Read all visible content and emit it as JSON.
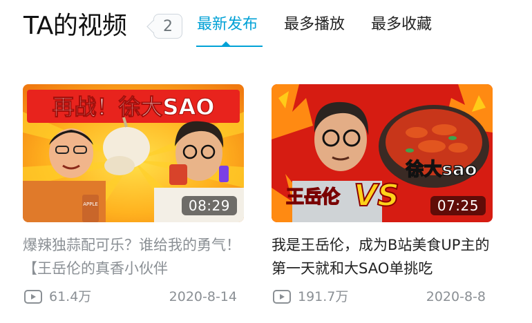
{
  "header": {
    "title": "TA的视频",
    "count": "2",
    "tabs": [
      {
        "label": "最新发布",
        "active": true
      },
      {
        "label": "最多播放",
        "active": false
      },
      {
        "label": "最多收藏",
        "active": false
      }
    ]
  },
  "videos": [
    {
      "thumb_text": "再战！徐大SAO",
      "thumb_product": "APPLE",
      "duration": "08:29",
      "title": "爆辣独蒜配可乐？谁给我的勇气！【王岳伦的真香小伙伴",
      "views": "61.4万",
      "date": "2020-8-14"
    },
    {
      "thumb_text_left": "王岳伦",
      "thumb_text_vs": "VS",
      "thumb_text_right": "徐大sao",
      "duration": "07:25",
      "title": "我是王岳伦，成为B站美食UP主的第一天就和大SAO单挑吃",
      "views": "191.7万",
      "date": "2020-8-8"
    }
  ],
  "colors": {
    "accent": "#00a1d6",
    "meta": "#8a8f94"
  }
}
